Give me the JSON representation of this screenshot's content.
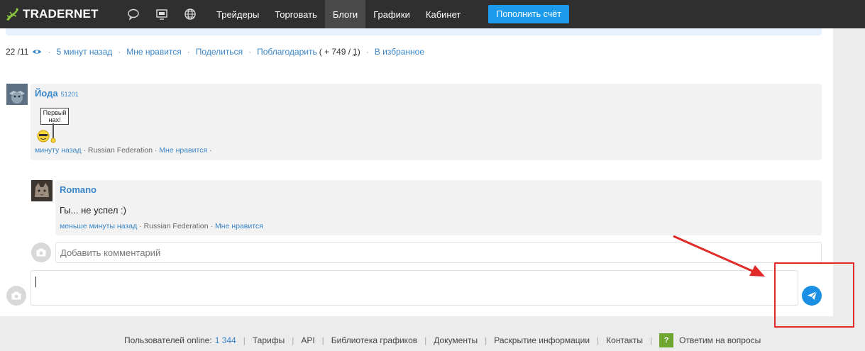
{
  "navbar": {
    "logo_text": "TRADERNET",
    "links": [
      "Трейдеры",
      "Торговать",
      "Блоги",
      "Графики",
      "Кабинет"
    ],
    "active_link": "Блоги",
    "topup_label": "Пополнить счёт",
    "icons": [
      "chat-bubble-icon",
      "monitor-icon",
      "globe-icon"
    ]
  },
  "post_meta": {
    "views": "22 /11",
    "time": "5 минут назад",
    "like": "Мне нравится",
    "share": "Поделиться",
    "thank": "Поблагодарить",
    "thanks_prefix": "( + 749 /",
    "thanks_count": "1",
    "thanks_suffix": ")",
    "favorite": "В избранное"
  },
  "comments": [
    {
      "author": "Йода",
      "rating": "51201",
      "sign_text": "Первый нах!",
      "time": "минуту назад",
      "country": "Russian Federation",
      "like": "Мне нравится"
    },
    {
      "author": "Romano",
      "text": "Гы... не успел :)",
      "time": "меньше минуты назад",
      "country": "Russian Federation",
      "like": "Мне нравится"
    }
  ],
  "reply": {
    "placeholder": "Добавить комментарий"
  },
  "footer": {
    "online_label": "Пользователей online:",
    "online_count": "1 344",
    "links": [
      "Тарифы",
      "API",
      "Библиотека графиков",
      "Документы",
      "Раскрытие информации",
      "Контакты"
    ],
    "help_badge": "?",
    "help_label": "Ответим на вопросы"
  },
  "colors": {
    "navbar": "#2f2f2f",
    "accent": "#1b9be9",
    "link": "#3a86c8",
    "annotation": "#e02a2a"
  }
}
